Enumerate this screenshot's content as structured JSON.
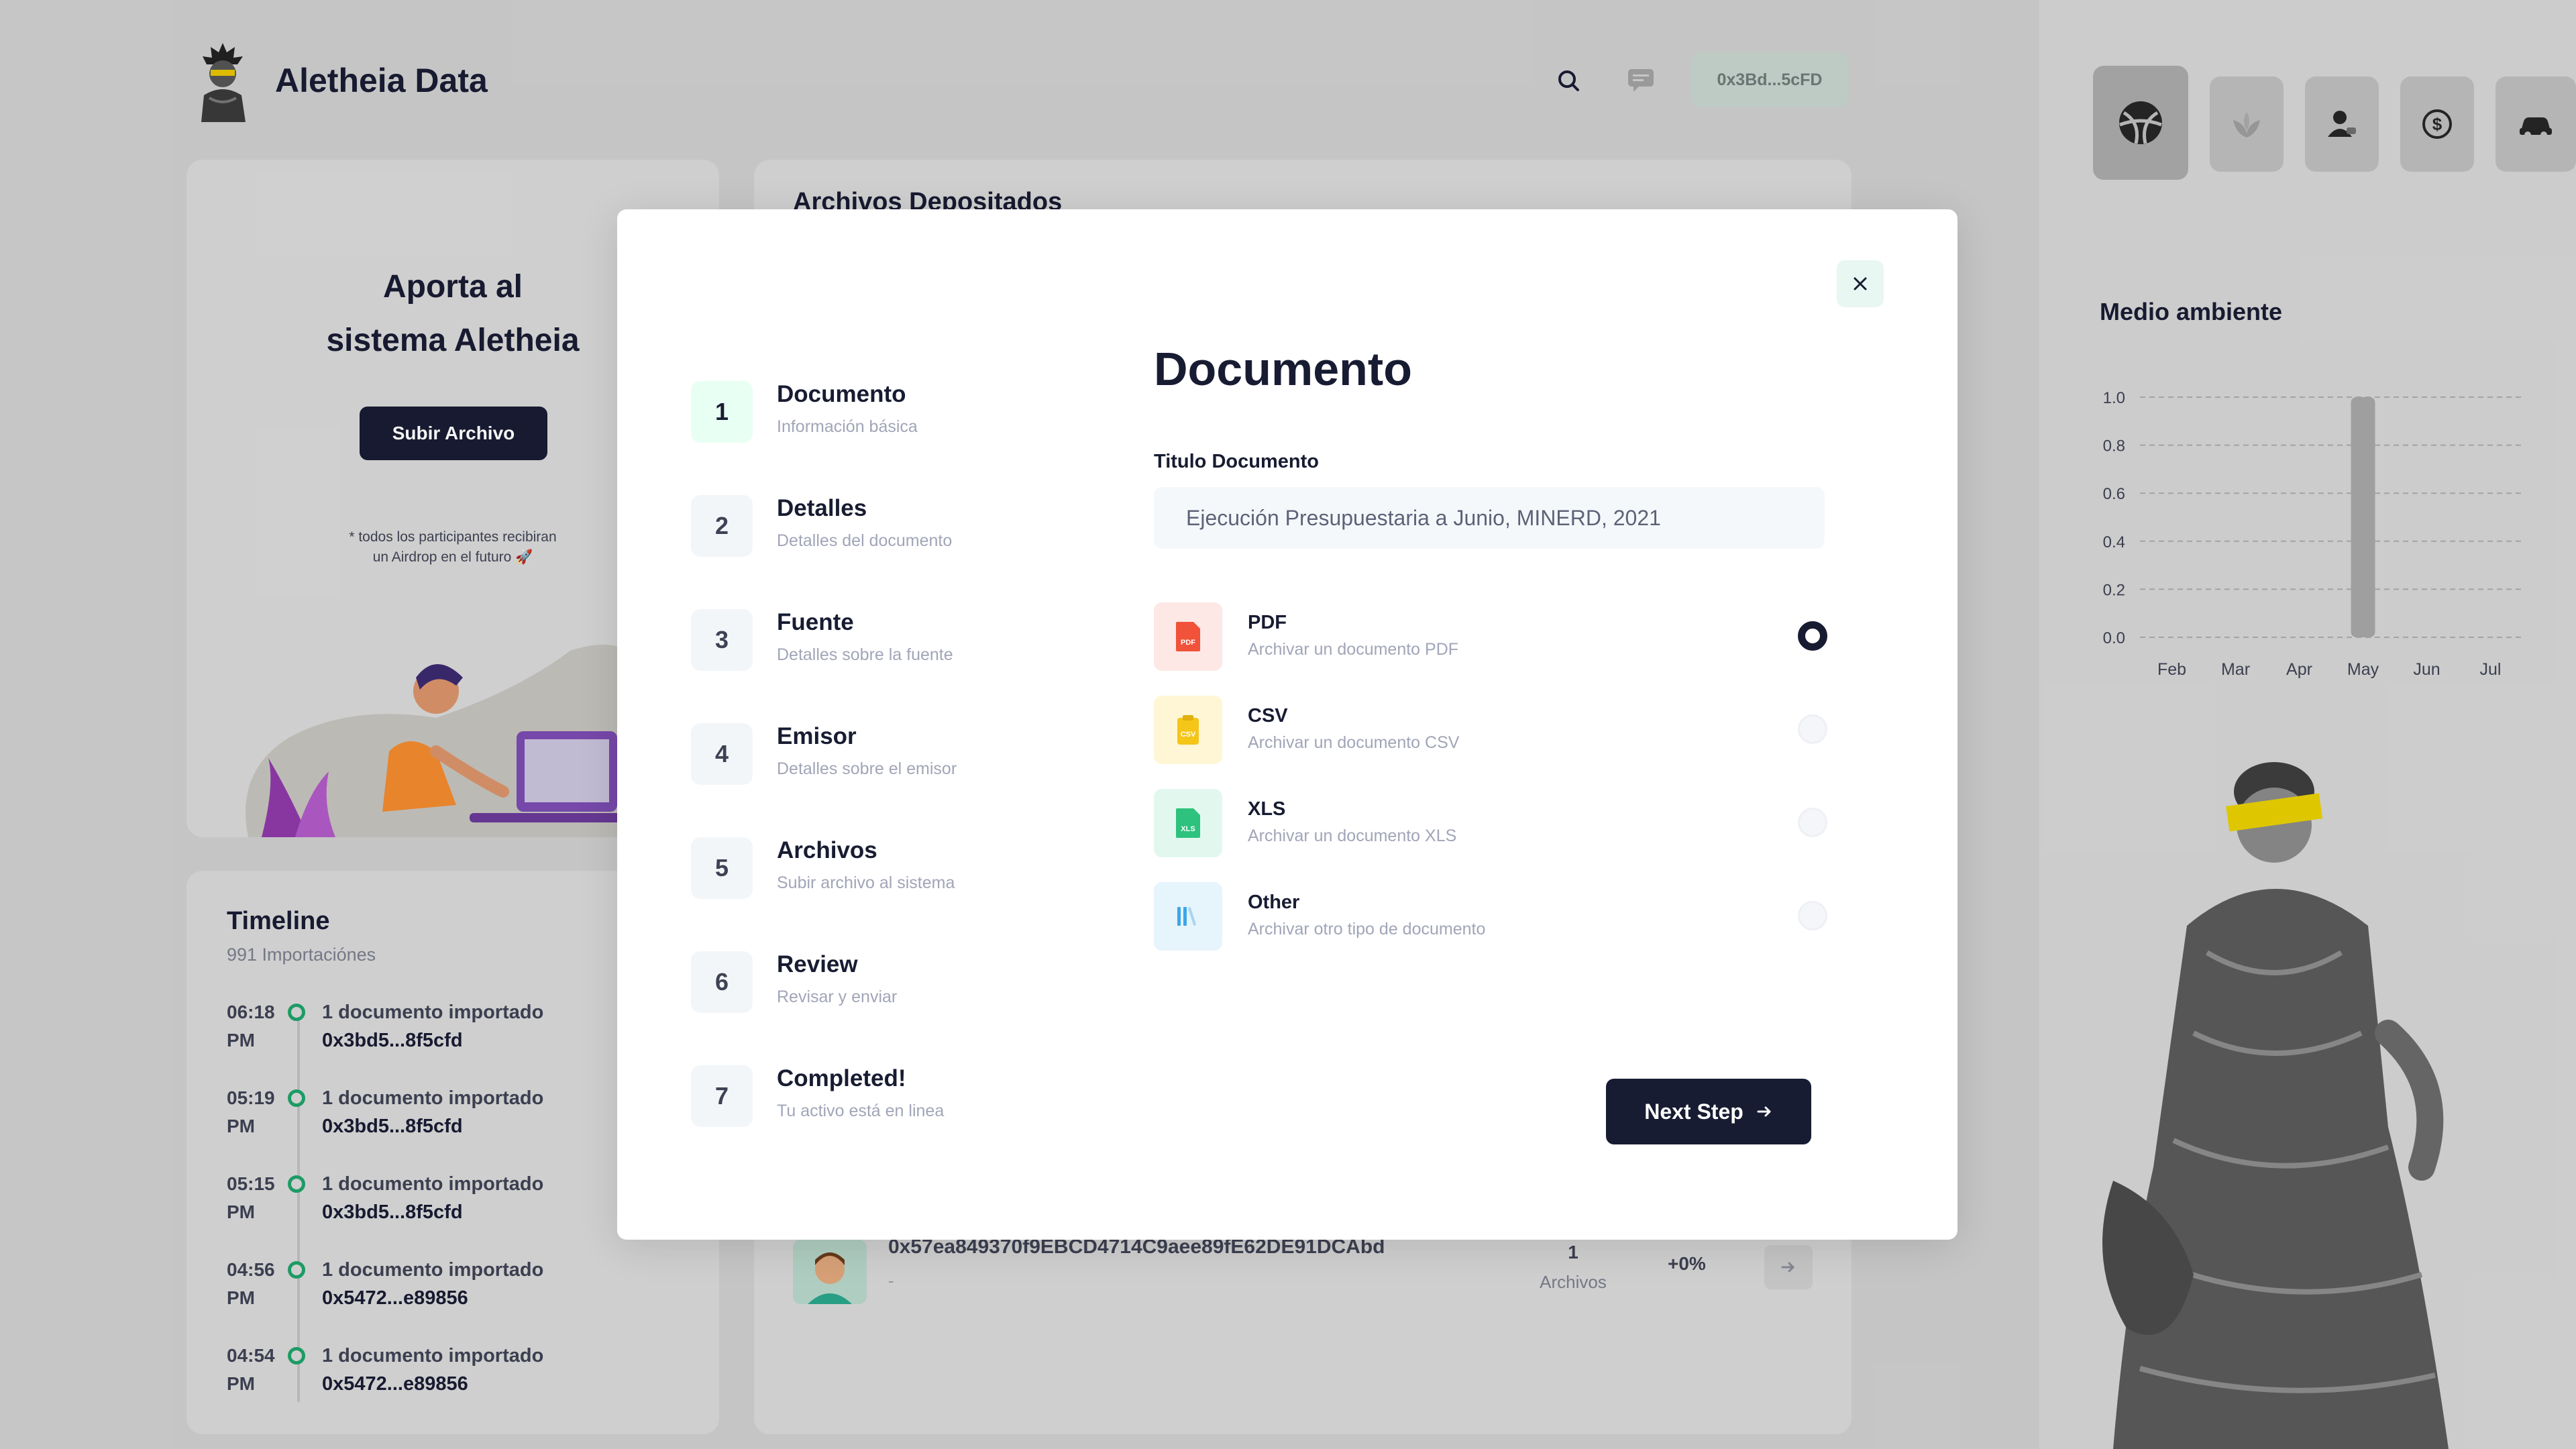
{
  "header": {
    "brand_name": "Aletheia Data",
    "wallet": "0x3Bd...5cFD"
  },
  "hero": {
    "title_line1": "Aporta al",
    "title_line2": "sistema Aletheia",
    "upload_button": "Subir Archivo",
    "note_line1": "* todos los participantes recibiran",
    "note_line2": "un Airdrop en el futuro 🚀"
  },
  "timeline": {
    "title": "Timeline",
    "subtitle": "991 Importaciónes",
    "items": [
      {
        "time": "06:18",
        "period": "PM",
        "text": "1 documento importado",
        "addr": "0x3bd5...8f5cfd"
      },
      {
        "time": "05:19",
        "period": "PM",
        "text": "1 documento importado",
        "addr": "0x3bd5...8f5cfd"
      },
      {
        "time": "05:15",
        "period": "PM",
        "text": "1 documento importado",
        "addr": "0x3bd5...8f5cfd"
      },
      {
        "time": "04:56",
        "period": "PM",
        "text": "1 documento importado",
        "addr": "0x5472...e89856"
      },
      {
        "time": "04:54",
        "period": "PM",
        "text": "1 documento importado",
        "addr": "0x5472...e89856"
      }
    ]
  },
  "files": {
    "title": "Archivos Depositados",
    "row": {
      "address": "0x57ea849370f9EBCD4714C9aee89fE62DE91DCAbd",
      "dash": "-",
      "count": "1",
      "count_label": "Archivos",
      "percent": "+0%"
    }
  },
  "sidebar": {
    "categories": [
      "sports-icon",
      "plant-icon",
      "user-icon",
      "money-icon",
      "car-icon"
    ],
    "chart_title": "Medio ambiente"
  },
  "chart_data": {
    "type": "bar",
    "title": "Medio ambiente",
    "categories": [
      "Feb",
      "Mar",
      "Apr",
      "May",
      "Jun",
      "Jul"
    ],
    "values": [
      0,
      0,
      0,
      1.0,
      0,
      0
    ],
    "yticks": [
      "1.0",
      "0.8",
      "0.6",
      "0.4",
      "0.2",
      "0.0"
    ],
    "ylim": [
      0,
      1.0
    ],
    "grid": true,
    "bar_color": "#a6a6a6"
  },
  "modal": {
    "steps": [
      {
        "num": "1",
        "title": "Documento",
        "subtitle": "Información básica"
      },
      {
        "num": "2",
        "title": "Detalles",
        "subtitle": "Detalles del documento"
      },
      {
        "num": "3",
        "title": "Fuente",
        "subtitle": "Detalles sobre la fuente"
      },
      {
        "num": "4",
        "title": "Emisor",
        "subtitle": "Detalles sobre el emisor"
      },
      {
        "num": "5",
        "title": "Archivos",
        "subtitle": "Subir archivo al sistema"
      },
      {
        "num": "6",
        "title": "Review",
        "subtitle": "Revisar y enviar"
      },
      {
        "num": "7",
        "title": "Completed!",
        "subtitle": "Tu activo está en linea"
      }
    ],
    "form_title": "Documento",
    "field_label": "Titulo Documento",
    "field_value": "Ejecución Presupuestaria a Junio, MINERD, 2021",
    "options": [
      {
        "title": "PDF",
        "subtitle": "Archivar un documento PDF",
        "icon": "pdf-icon",
        "bg": "#fff5f8",
        "color": "#f1416c",
        "checked": true
      },
      {
        "title": "CSV",
        "subtitle": "Archivar un documento CSV",
        "icon": "csv-icon",
        "bg": "#fff8dd",
        "color": "#ffc700",
        "checked": false
      },
      {
        "title": "XLS",
        "subtitle": "Archivar un documento XLS",
        "icon": "xls-icon",
        "bg": "#e8fff3",
        "color": "#50cd89",
        "checked": false
      },
      {
        "title": "Other",
        "subtitle": "Archivar otro tipo de documento",
        "icon": "library-icon",
        "bg": "#f1faff",
        "color": "#009ef7",
        "checked": false
      }
    ],
    "next_button": "Next Step"
  }
}
